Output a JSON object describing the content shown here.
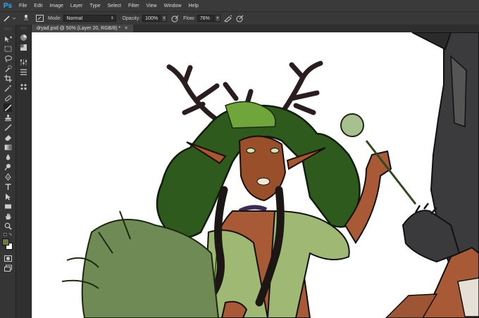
{
  "app": {
    "logo": "Ps"
  },
  "menu": [
    "File",
    "Edit",
    "Image",
    "Layer",
    "Type",
    "Select",
    "Filter",
    "View",
    "Window",
    "Help"
  ],
  "options": {
    "brush_size": "25",
    "mode_label": "Mode:",
    "mode_value": "Normal",
    "opacity_label": "Opacity:",
    "opacity_value": "100%",
    "flow_label": "Flow:",
    "flow_value": "76%"
  },
  "document": {
    "tab_title": "dryad.psd @ 50% (Layer 20, RGB/8) *",
    "close_glyph": "×"
  },
  "colors": {
    "foreground": "#6b7a45",
    "background": "#ffffff",
    "accent": "#31a8ff"
  },
  "tools": [
    "move-icon",
    "marquee-icon",
    "lasso-icon",
    "quick-select-icon",
    "crop-icon",
    "eyedropper-icon",
    "healing-icon",
    "brush-icon",
    "clone-stamp-icon",
    "history-brush-icon",
    "eraser-icon",
    "gradient-icon",
    "blur-icon",
    "dodge-icon",
    "pen-icon",
    "type-icon",
    "path-select-icon",
    "rectangle-icon",
    "hand-icon",
    "zoom-icon"
  ]
}
